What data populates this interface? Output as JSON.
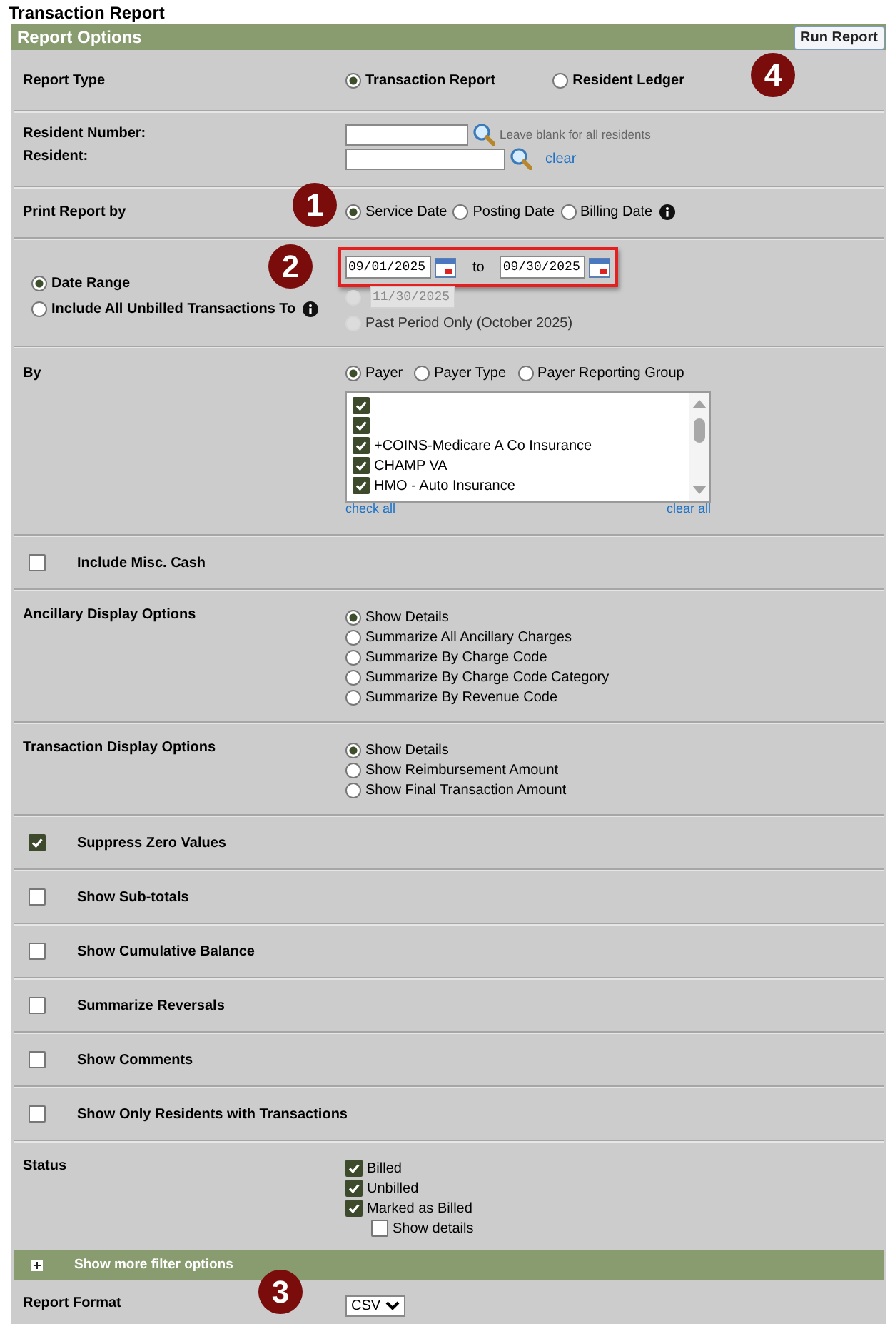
{
  "page_title": "Transaction Report",
  "panel": {
    "title": "Report Options",
    "run_button": "Run Report"
  },
  "sections": [
    {
      "kind": "radio_row",
      "label": "Report Type",
      "options": [
        {
          "label": "Transaction Report",
          "selected": true
        },
        {
          "label": "Resident Ledger",
          "selected": false
        }
      ]
    },
    {
      "kind": "resident",
      "number_label": "Resident Number:",
      "number_hint": "Leave blank for all residents",
      "resident_label": "Resident:",
      "clear_link": "clear"
    },
    {
      "kind": "radio_inline",
      "label": "Print Report by",
      "options": [
        {
          "label": "Service Date",
          "selected": true
        },
        {
          "label": "Posting Date",
          "selected": false
        },
        {
          "label": "Billing Date",
          "selected": false,
          "info": true
        }
      ]
    },
    {
      "kind": "date",
      "highlighted": true,
      "options": [
        {
          "label": "Date Range",
          "selected": true
        },
        {
          "label": "Include All Unbilled Transactions To",
          "selected": false,
          "info": true
        }
      ],
      "from": "09/01/2025",
      "to_label": "to",
      "to": "09/30/2025",
      "unbilled": {
        "value": "11/30/2025",
        "selected": false,
        "disabled": true
      },
      "past_period": {
        "label": "Past Period Only (October 2025)",
        "selected": false,
        "disabled": true
      }
    },
    {
      "kind": "by",
      "label": "By",
      "options": [
        {
          "label": "Payer",
          "selected": true
        },
        {
          "label": "Payer Type",
          "selected": false
        },
        {
          "label": "Payer Reporting Group",
          "selected": false
        }
      ],
      "items": [
        {
          "checked": true
        },
        {
          "checked": true
        },
        {
          "label": "+COINS-Medicare A Co Insurance",
          "checked": true
        },
        {
          "label": "CHAMP VA",
          "checked": true
        },
        {
          "label": "HMO - Auto Insurance",
          "checked": true
        }
      ],
      "check_all": "check all",
      "clear_all": "clear all"
    },
    {
      "kind": "checkbox",
      "label": "Include Misc. Cash",
      "checked": false
    },
    {
      "kind": "radio_list",
      "label": "Ancillary Display Options",
      "options": [
        {
          "label": "Show Details",
          "selected": true
        },
        {
          "label": "Summarize All Ancillary Charges",
          "selected": false
        },
        {
          "label": "Summarize By Charge Code",
          "selected": false
        },
        {
          "label": "Summarize By Charge Code Category",
          "selected": false
        },
        {
          "label": "Summarize By Revenue Code",
          "selected": false
        }
      ]
    },
    {
      "kind": "radio_list",
      "label": "Transaction Display Options",
      "options": [
        {
          "label": "Show Details",
          "selected": true
        },
        {
          "label": "Show Reimbursement Amount",
          "selected": false
        },
        {
          "label": "Show Final Transaction Amount",
          "selected": false
        }
      ]
    },
    {
      "kind": "checkbox",
      "label": "Suppress Zero Values",
      "checked": true
    },
    {
      "kind": "checkbox",
      "label": "Show Sub-totals",
      "checked": false
    },
    {
      "kind": "checkbox",
      "label": "Show Cumulative Balance",
      "checked": false
    },
    {
      "kind": "checkbox",
      "label": "Summarize Reversals",
      "checked": false
    },
    {
      "kind": "checkbox",
      "label": "Show Comments",
      "checked": false
    },
    {
      "kind": "checkbox",
      "label": "Show Only Residents with Transactions",
      "checked": false
    },
    {
      "kind": "check_list",
      "label": "Status",
      "items": [
        {
          "label": "Billed",
          "checked": true
        },
        {
          "label": "Unbilled",
          "checked": true
        },
        {
          "label": "Marked as Billed",
          "checked": true,
          "children": [
            {
              "label": "Show details",
              "checked": false
            }
          ]
        }
      ]
    },
    {
      "kind": "expander",
      "label": "Show more filter options",
      "expanded": false
    },
    {
      "kind": "select",
      "label": "Report Format",
      "value": "CSV"
    }
  ],
  "markers": [
    {
      "label": "1"
    },
    {
      "label": "2"
    },
    {
      "label": "3"
    },
    {
      "label": "4"
    }
  ]
}
